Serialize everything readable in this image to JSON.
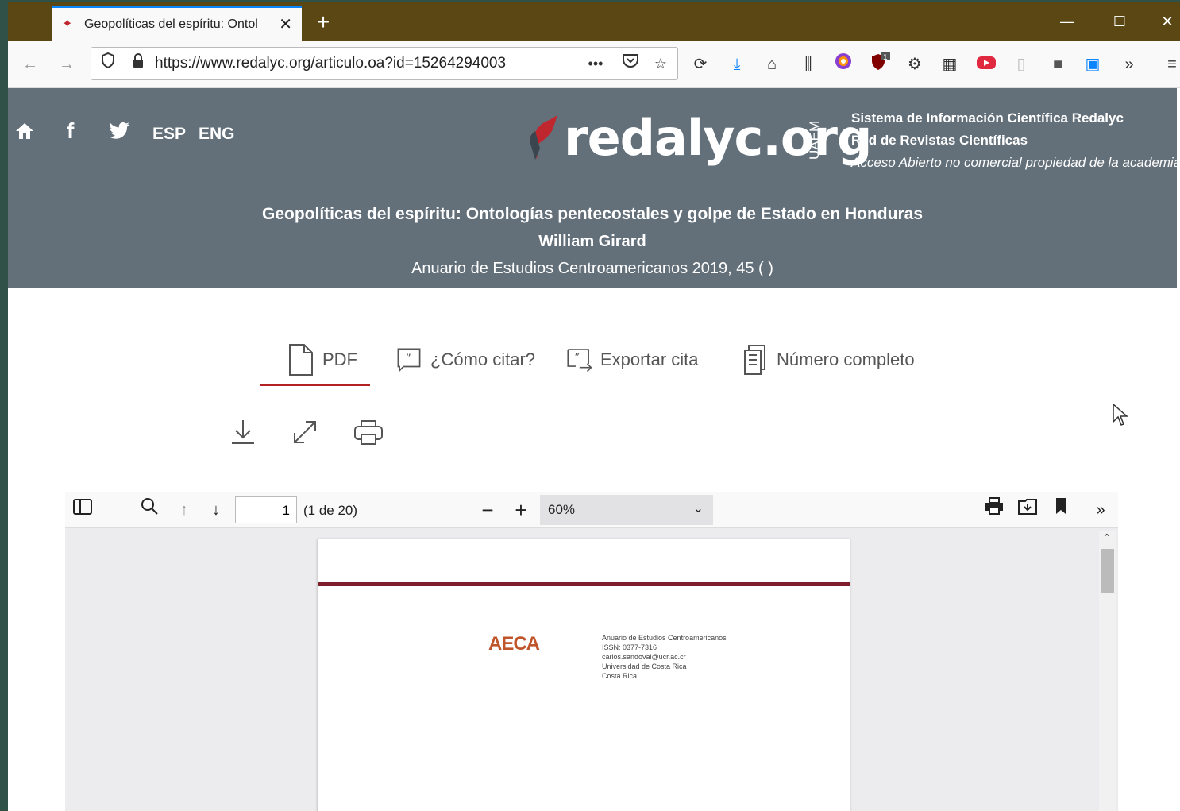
{
  "browser": {
    "tab_title": "Geopolíticas del espíritu: Ontol",
    "url": "https://www.redalyc.org/articulo.oa?id=15264294003",
    "badge_count": "1"
  },
  "header": {
    "lang_es": "ESP",
    "lang_en": "ENG",
    "logo_text": "redalyc.org",
    "uaem": "UAEM",
    "system_name": "Sistema de Información Científica Redalyc",
    "network_name": "Red de Revistas Científicas",
    "tagline": "Acceso Abierto no comercial propiedad de la academia"
  },
  "article": {
    "title": "Geopolíticas del espíritu: Ontologías pentecostales y golpe de Estado en Honduras",
    "author": "William Girard",
    "journal": "Anuario de Estudios Centroamericanos 2019,  45 ( )"
  },
  "tabs": {
    "pdf": "PDF",
    "cite": "¿Cómo citar?",
    "export": "Exportar cita",
    "issue": "Número completo"
  },
  "pdf_viewer": {
    "page_number": "1",
    "page_count": "(1 de 20)",
    "zoom": "60%"
  },
  "pdf_page": {
    "logo_text": "AECA",
    "info_lines": [
      "Anuario de Estudios Centroamericanos",
      "ISSN: 0377-7316",
      "carlos.sandoval@ucr.ac.cr",
      "Universidad de Costa Rica",
      "Costa Rica"
    ]
  }
}
